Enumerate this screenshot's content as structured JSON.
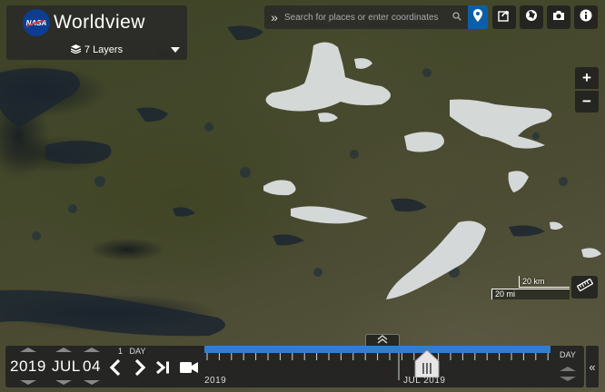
{
  "app": {
    "title": "Worldview",
    "logo_text": "NASA"
  },
  "layers": {
    "label": "7 Layers"
  },
  "search": {
    "placeholder": "Search for places or enter coordinates"
  },
  "toolbar": {
    "icons": [
      "share-icon",
      "projection-icon",
      "camera-icon",
      "info-icon"
    ]
  },
  "zoom": {
    "in_label": "+",
    "out_label": "−"
  },
  "scale": {
    "km_label": "20 km",
    "mi_label": "20 mi"
  },
  "date": {
    "year": "2019",
    "month": "JUL",
    "day": "04",
    "interval_value": "1",
    "interval_unit": "DAY"
  },
  "timeline": {
    "start_label": "2019",
    "current_label": "JUL 2019",
    "zoom_level": "DAY"
  },
  "colors": {
    "accent": "#2f7fd1",
    "pin_button": "#0b5fa8",
    "panel": "#222222"
  }
}
